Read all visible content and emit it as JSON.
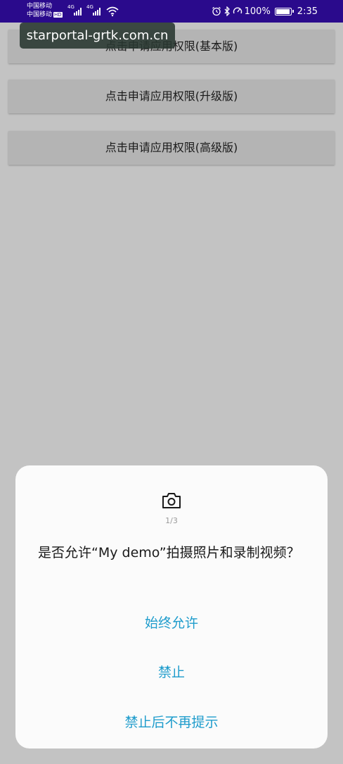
{
  "status_bar": {
    "carrier_1": "中国移动",
    "carrier_2": "中国移动",
    "hd_badge": "HD",
    "net_1": "4G",
    "net_2": "4G",
    "battery_text": "100%",
    "battery_level": 1.0,
    "time": "2:35"
  },
  "watermark": "starportal-grtk.com.cn",
  "buttons": [
    {
      "label": "点击申请应用权限(基本版)"
    },
    {
      "label": "点击申请应用权限(升级版)"
    },
    {
      "label": "点击申请应用权限(高级版)"
    }
  ],
  "dialog": {
    "icon": "camera-icon",
    "page_indicator": "1/3",
    "message": "是否允许“My demo”拍摄照片和录制视频？",
    "actions": [
      {
        "label": "始终允许"
      },
      {
        "label": "禁止"
      },
      {
        "label": "禁止后不再提示"
      }
    ],
    "accent_color": "#1e9ccc"
  },
  "colors": {
    "status_bar": "#2a0a8c",
    "dim_background": "#c3c3c3",
    "button": "#b4b4b4"
  }
}
